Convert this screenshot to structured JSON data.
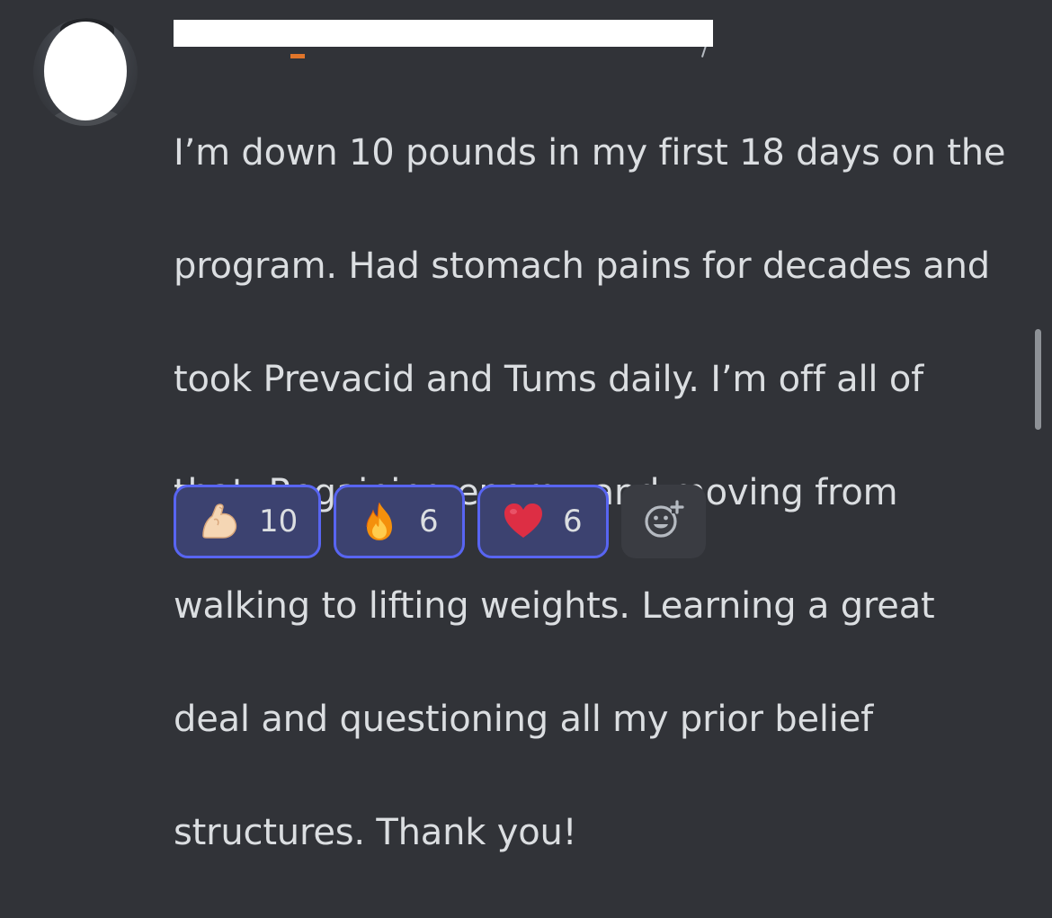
{
  "message": {
    "text_lines": [
      "I’m down 10 pounds in my first 18 days on the",
      "program.  Had stomach pains for decades and",
      "took Prevacid and Tums daily.  I’m off all of",
      "that.  Regaining energy and moving from",
      "walking to lifting weights.  Learning a great",
      "deal and questioning all my prior belief",
      "structures.  Thank you!"
    ]
  },
  "reactions": [
    {
      "emoji": "flexed-biceps-icon",
      "count": "10"
    },
    {
      "emoji": "fire-icon",
      "count": "6"
    },
    {
      "emoji": "red-heart-icon",
      "count": "6"
    }
  ],
  "add_reaction": {
    "icon": "smile-plus-icon"
  },
  "colors": {
    "background": "#313338",
    "text": "#dbdee1",
    "reaction_border": "#5865f2",
    "reaction_bg": "#3c4270",
    "add_bg": "#3a3c42"
  }
}
